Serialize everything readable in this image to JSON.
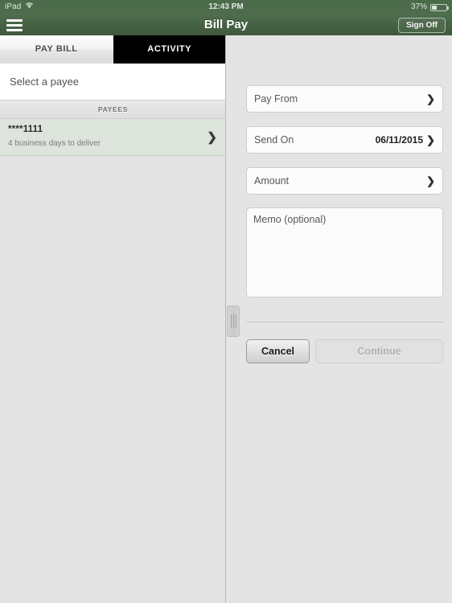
{
  "status_bar": {
    "device": "iPad",
    "wifi_icon": "wifi-icon",
    "time": "12:43 PM",
    "battery_percent": "37%",
    "battery_icon": "battery-icon"
  },
  "navbar": {
    "menu_icon": "hamburger-menu-icon",
    "title": "Bill Pay",
    "sign_off_label": "Sign Off"
  },
  "master": {
    "tabs": [
      {
        "label": "PAY BILL",
        "active": false
      },
      {
        "label": "ACTIVITY",
        "active": true
      }
    ],
    "payee_prompt": "Select a payee",
    "section_header": "PAYEES",
    "payees": [
      {
        "name": "****1111",
        "detail": "4 business days to deliver",
        "chevron_icon": "chevron-right-icon"
      }
    ]
  },
  "divider": {
    "handle_icon": "split-view-drag-handle-icon"
  },
  "detail": {
    "fields": [
      {
        "label": "Pay From",
        "value": "",
        "chevron_icon": "chevron-right-icon"
      },
      {
        "label": "Send On",
        "value": "06/11/2015",
        "chevron_icon": "chevron-right-icon"
      },
      {
        "label": "Amount",
        "value": "",
        "chevron_icon": "chevron-right-icon"
      }
    ],
    "memo_placeholder": "Memo (optional)",
    "memo_value": "",
    "buttons": {
      "cancel_label": "Cancel",
      "continue_label": "Continue",
      "continue_enabled": false
    }
  },
  "colors": {
    "header_green": "#456143",
    "selected_row_green": "#dde4dc",
    "active_tab": "#000000",
    "pane_background": "#e4e4e4"
  }
}
